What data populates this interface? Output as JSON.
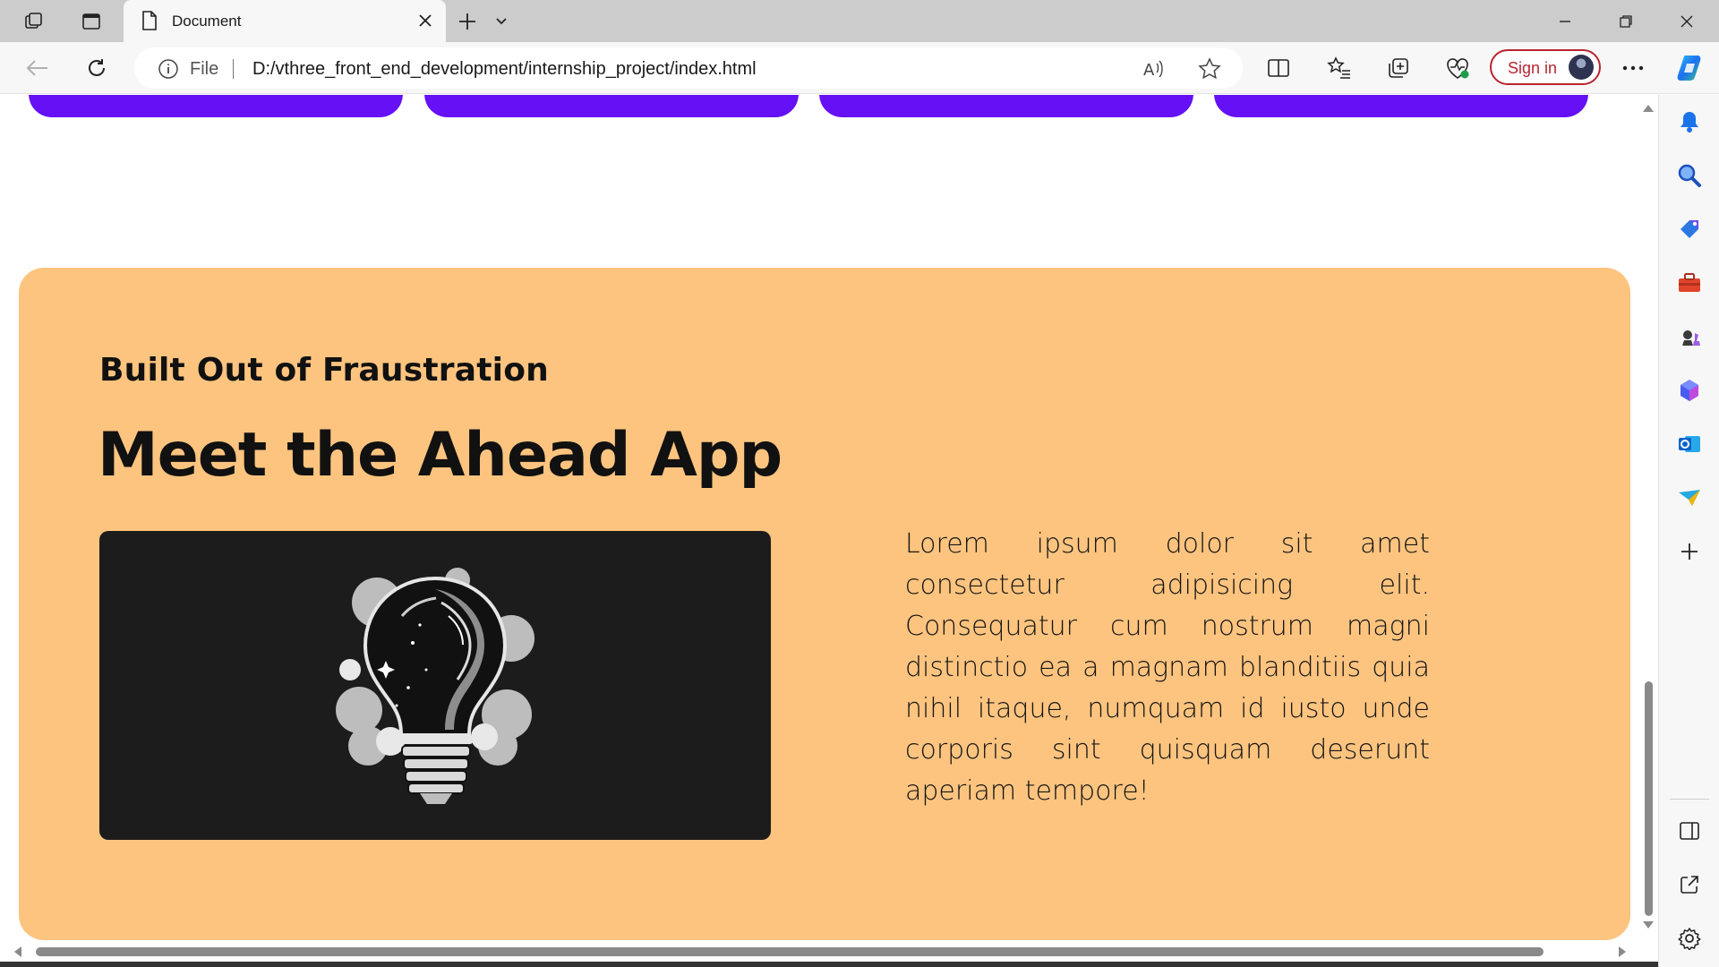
{
  "browser": {
    "tab": {
      "title": "Document",
      "icon": "page-icon"
    },
    "address": {
      "scheme_label": "File",
      "url": "D:/vthree_front_end_development/internship_project/index.html"
    },
    "sign_in_label": "Sign in",
    "colors": {
      "accent": "#b8252f",
      "titlebar": "#cccccc",
      "toolbar": "#f7f7f7"
    }
  },
  "page": {
    "colors": {
      "pill": "#6510f5",
      "card": "#fdc47f",
      "image_panel": "#1c1c1c"
    },
    "eyebrow": "Built Out of Fraustration",
    "headline": "Meet the Ahead App",
    "body": "Lorem ipsum dolor sit amet consectetur adipisicing elit. Consequatur cum nostrum magni distinctio ea a magnam blanditiis quia nihil itaque, numquam id iusto unde corporis sint quisquam deserunt aperiam tempore!",
    "image": {
      "subject": "light-bulb-illustration"
    }
  },
  "sidebar": {
    "icons": [
      "bell-icon",
      "search-icon",
      "tag-icon",
      "toolbox-icon",
      "chess-icon",
      "office-icon",
      "outlook-icon",
      "send-icon",
      "add-icon",
      "split-panel-icon",
      "external-link-icon",
      "settings-icon"
    ]
  }
}
